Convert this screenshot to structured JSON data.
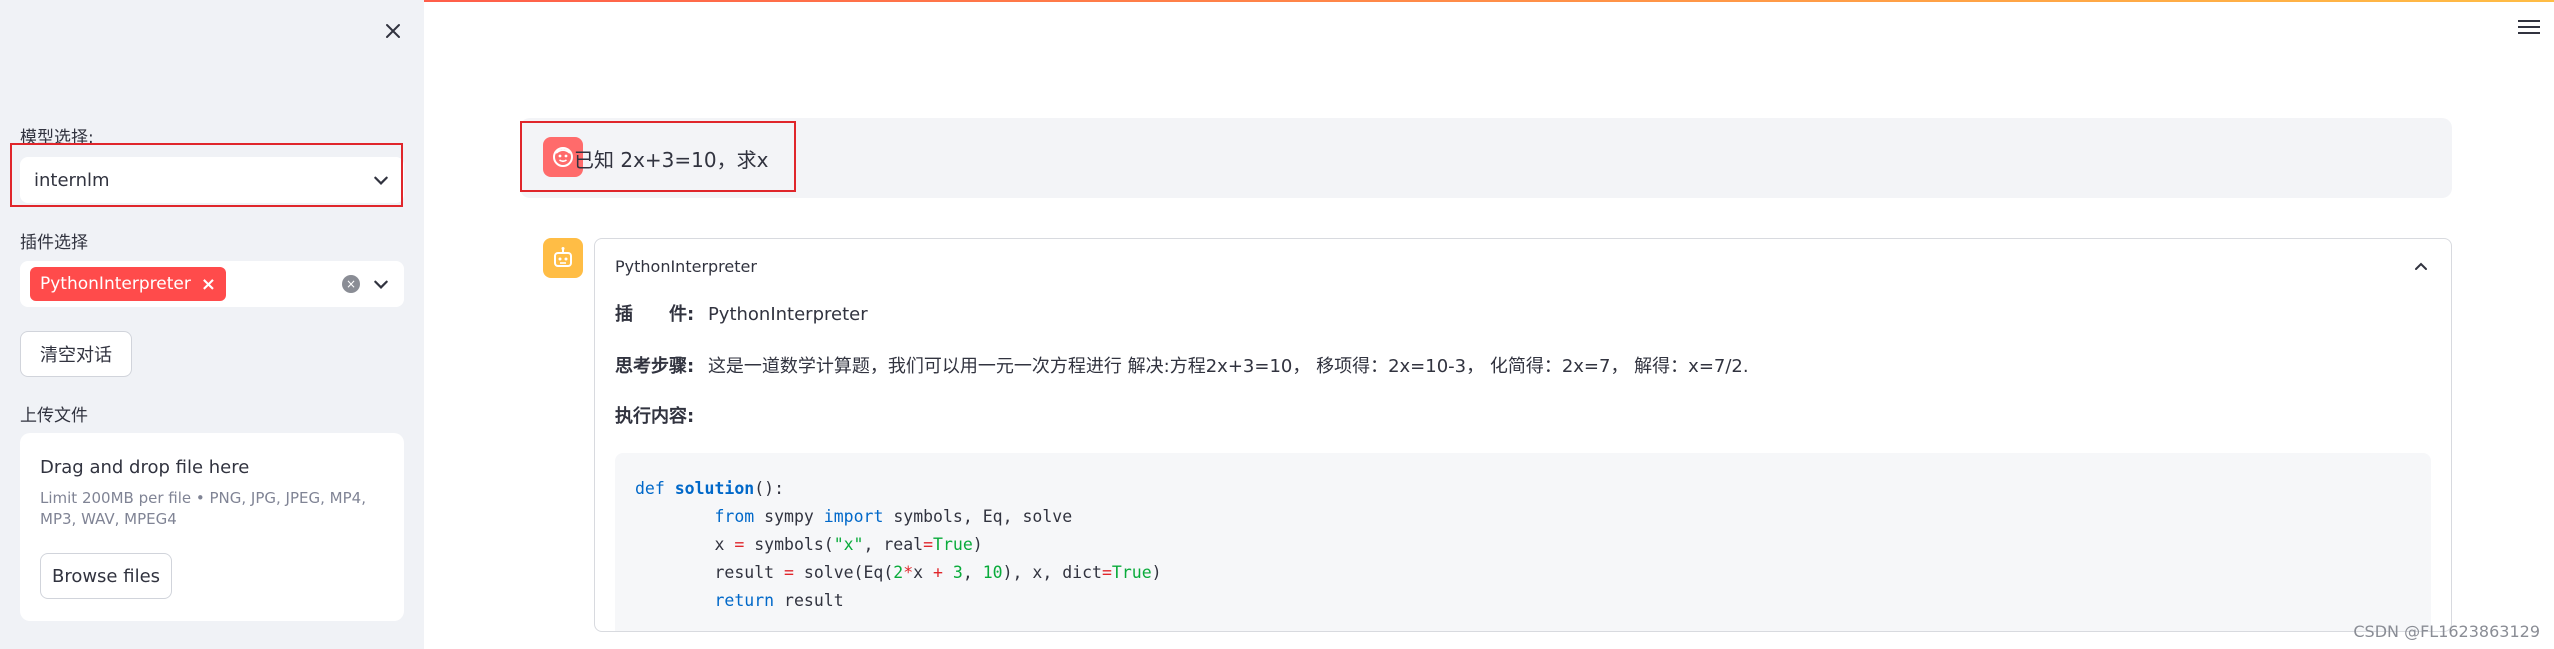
{
  "sidebar": {
    "model_label": "模型选择:",
    "model_value": "internlm",
    "plugin_label": "插件选择",
    "plugin_tag": "PythonInterpreter",
    "clear_button": "清空对话",
    "upload_label": "上传文件",
    "upload_title": "Drag and drop file here",
    "upload_limit": "Limit 200MB per file • PNG, JPG, JPEG, MP4, MP3, WAV, MPEG4",
    "browse_button": "Browse files"
  },
  "chat": {
    "user_message": "已知 2x+3=10，求x",
    "assistant": {
      "expander_title": "PythonInterpreter",
      "plugin_key": "插　　件:",
      "plugin_value": "PythonInterpreter",
      "thought_key": "思考步骤:",
      "thought_value": "这是一道数学计算题，我们可以用一元一次方程进行 解决:方程2x+3=10， 移项得：2x=10-3， 化简得：2x=7， 解得：x=7/2.",
      "exec_key": "执行内容:",
      "code_lines": [
        "def solution():",
        "        from sympy import symbols, Eq, solve",
        "        x = symbols(\"x\", real=True)",
        "        result = solve(Eq(2*x + 3, 10), x, dict=True)",
        "        return result"
      ]
    }
  },
  "watermark": "CSDN @FL1623863129",
  "colors": {
    "accent": "#ff4b4b",
    "sidebar_bg": "#f0f2f6",
    "highlight_border": "#e0262b",
    "user_avatar": "#ff6b6b",
    "assistant_avatar": "#ffbd45"
  },
  "icons": {
    "close": "close-icon",
    "menu": "hamburger-menu-icon",
    "dropdown": "chevron-down-icon",
    "collapse": "chevron-up-icon",
    "user": "user-face-icon",
    "bot": "robot-icon"
  }
}
